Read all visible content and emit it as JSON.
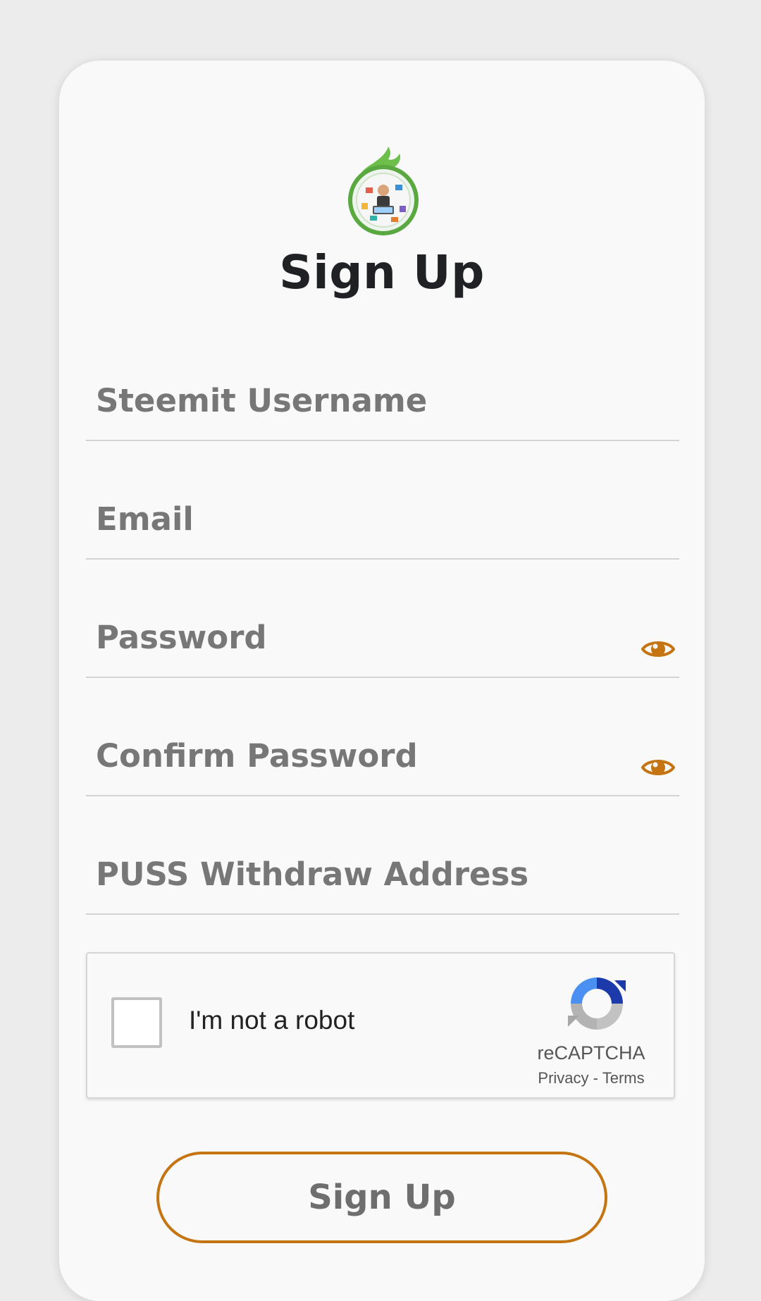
{
  "header": {
    "title": "Sign Up",
    "logo_icon": "leaf-globe-logo"
  },
  "form": {
    "username": {
      "placeholder": "Steemit Username",
      "value": ""
    },
    "email": {
      "placeholder": "Email",
      "value": ""
    },
    "password": {
      "placeholder": "Password",
      "value": "",
      "toggle_icon": "eye-icon"
    },
    "confirm_password": {
      "placeholder": "Confirm Password",
      "value": "",
      "toggle_icon": "eye-icon"
    },
    "withdraw_address": {
      "placeholder": "PUSS Withdraw Address",
      "value": ""
    }
  },
  "captcha": {
    "label": "I'm not a robot",
    "brand": "reCAPTCHA",
    "privacy": "Privacy",
    "separator": "-",
    "terms": "Terms",
    "checked": false
  },
  "submit": {
    "label": "Sign Up"
  },
  "colors": {
    "accent": "#c47512",
    "background": "#ececec",
    "card": "#f9f9f9",
    "title": "#1f2124",
    "placeholder": "#777777",
    "divider": "#d3d3d3"
  }
}
